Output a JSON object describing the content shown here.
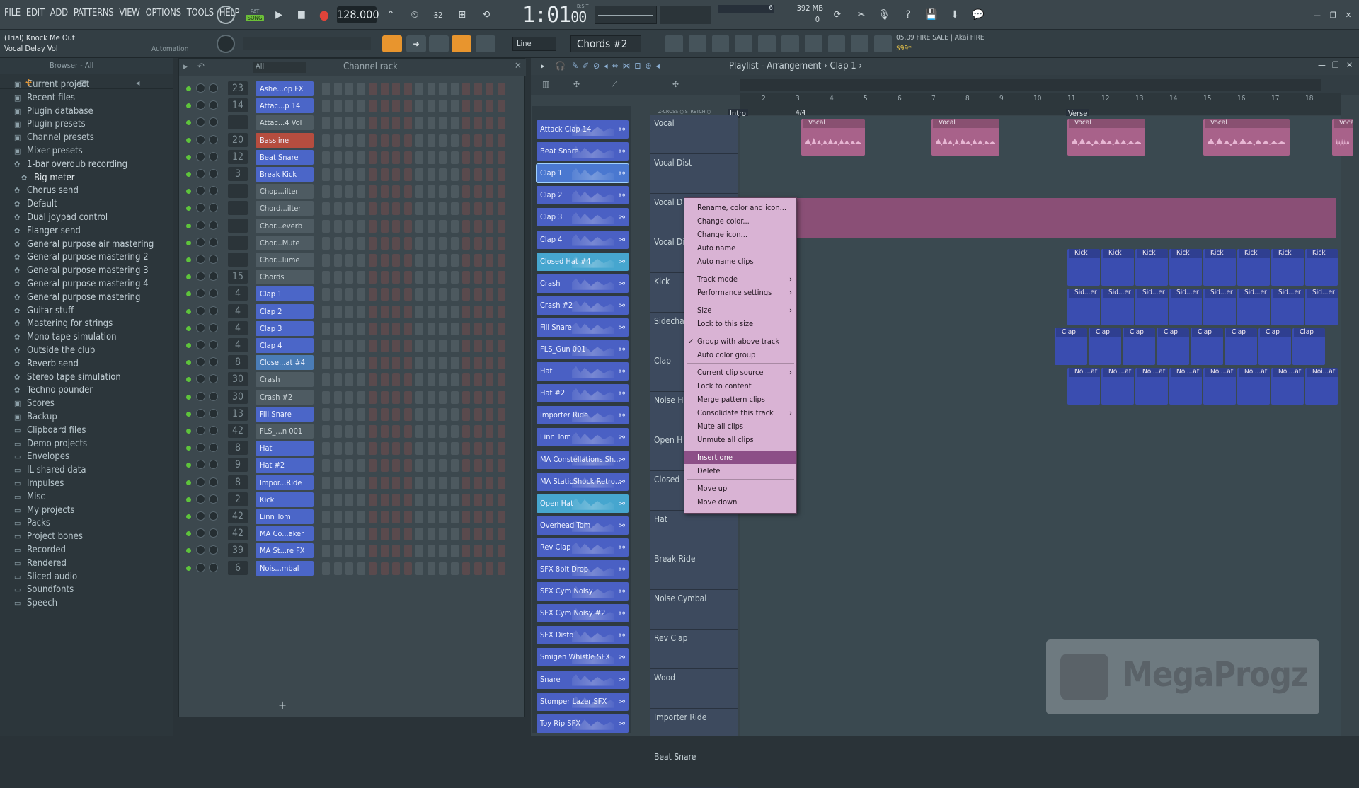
{
  "menu": [
    "FILE",
    "EDIT",
    "ADD",
    "PATTERNS",
    "VIEW",
    "OPTIONS",
    "TOOLS",
    "HELP"
  ],
  "transport": {
    "pat_label": "PAT",
    "song_label": "SONG",
    "bpm": "128.000",
    "time": "1:01",
    "time_sub": "00",
    "bst": "B:S:T"
  },
  "memory": {
    "value": "392 MB",
    "zero": "0",
    "cpu": "6"
  },
  "hint": {
    "line1": "(Trial) Knock Me Out",
    "line2": "Vocal Delay Vol",
    "line3": "Automation"
  },
  "snap": {
    "value": "Line"
  },
  "pattern": {
    "value": "Chords #2"
  },
  "news": {
    "line1": "05.09  FIRE SALE | Akai FIRE",
    "line2": "$99*"
  },
  "browser": {
    "title": "Browser - All",
    "items": [
      {
        "label": "Current project",
        "kind": "sec"
      },
      {
        "label": "Recent files",
        "kind": "sec"
      },
      {
        "label": "Plugin database",
        "kind": "sec"
      },
      {
        "label": "Plugin presets",
        "kind": "sec"
      },
      {
        "label": "Channel presets",
        "kind": "sec"
      },
      {
        "label": "Mixer presets",
        "kind": "sec"
      },
      {
        "label": "1-bar overdub recording",
        "kind": "item"
      },
      {
        "label": "Big meter",
        "kind": "hl"
      },
      {
        "label": "Chorus send",
        "kind": "item"
      },
      {
        "label": "Default",
        "kind": "item"
      },
      {
        "label": "Dual joypad control",
        "kind": "item"
      },
      {
        "label": "Flanger send",
        "kind": "item"
      },
      {
        "label": "General purpose air mastering",
        "kind": "item"
      },
      {
        "label": "General purpose mastering 2",
        "kind": "item"
      },
      {
        "label": "General purpose mastering 3",
        "kind": "item"
      },
      {
        "label": "General purpose mastering 4",
        "kind": "item"
      },
      {
        "label": "General purpose mastering",
        "kind": "item"
      },
      {
        "label": "Guitar stuff",
        "kind": "item"
      },
      {
        "label": "Mastering for strings",
        "kind": "item"
      },
      {
        "label": "Mono tape simulation",
        "kind": "item"
      },
      {
        "label": "Outside the club",
        "kind": "item"
      },
      {
        "label": "Reverb send",
        "kind": "item"
      },
      {
        "label": "Stereo tape simulation",
        "kind": "item"
      },
      {
        "label": "Techno pounder",
        "kind": "item"
      },
      {
        "label": "Scores",
        "kind": "sec"
      },
      {
        "label": "Backup",
        "kind": "sec"
      },
      {
        "label": "Clipboard files",
        "kind": "f"
      },
      {
        "label": "Demo projects",
        "kind": "f"
      },
      {
        "label": "Envelopes",
        "kind": "f"
      },
      {
        "label": "IL shared data",
        "kind": "f"
      },
      {
        "label": "Impulses",
        "kind": "f"
      },
      {
        "label": "Misc",
        "kind": "f"
      },
      {
        "label": "My projects",
        "kind": "f"
      },
      {
        "label": "Packs",
        "kind": "f"
      },
      {
        "label": "Project bones",
        "kind": "f"
      },
      {
        "label": "Recorded",
        "kind": "f"
      },
      {
        "label": "Rendered",
        "kind": "f"
      },
      {
        "label": "Sliced audio",
        "kind": "f"
      },
      {
        "label": "Soundfonts",
        "kind": "f"
      },
      {
        "label": "Speech",
        "kind": "f"
      }
    ]
  },
  "channel_rack": {
    "title": "Channel rack",
    "filter": "All",
    "channels": [
      {
        "num": "23",
        "name": "Ashe...op FX",
        "style": "blue"
      },
      {
        "num": "14",
        "name": "Attac...p 14",
        "style": "blue"
      },
      {
        "num": "",
        "name": "Attac...4 Vol",
        "style": "gray"
      },
      {
        "num": "20",
        "name": "Bassline",
        "style": "red"
      },
      {
        "num": "12",
        "name": "Beat Snare",
        "style": "blue"
      },
      {
        "num": "3",
        "name": "Break Kick",
        "style": "blue"
      },
      {
        "num": "",
        "name": "Chop...ilter",
        "style": "gray"
      },
      {
        "num": "",
        "name": "Chord...ilter",
        "style": "gray"
      },
      {
        "num": "",
        "name": "Chor...everb",
        "style": "gray"
      },
      {
        "num": "",
        "name": "Chor...Mute",
        "style": "gray"
      },
      {
        "num": "",
        "name": "Chor...lume",
        "style": "gray"
      },
      {
        "num": "15",
        "name": "Chords",
        "style": "gray"
      },
      {
        "num": "4",
        "name": "Clap 1",
        "style": "blue"
      },
      {
        "num": "4",
        "name": "Clap 2",
        "style": "blue"
      },
      {
        "num": "4",
        "name": "Clap 3",
        "style": "blue"
      },
      {
        "num": "4",
        "name": "Clap 4",
        "style": "blue"
      },
      {
        "num": "8",
        "name": "Close...at #4",
        "style": "sel"
      },
      {
        "num": "30",
        "name": "Crash",
        "style": "gray"
      },
      {
        "num": "30",
        "name": "Crash #2",
        "style": "gray"
      },
      {
        "num": "13",
        "name": "Fill Snare",
        "style": "blue"
      },
      {
        "num": "42",
        "name": "FLS_...n 001",
        "style": "gray"
      },
      {
        "num": "8",
        "name": "Hat",
        "style": "blue"
      },
      {
        "num": "9",
        "name": "Hat #2",
        "style": "blue"
      },
      {
        "num": "8",
        "name": "Impor...Ride",
        "style": "blue"
      },
      {
        "num": "2",
        "name": "Kick",
        "style": "blue"
      },
      {
        "num": "42",
        "name": "Linn Tom",
        "style": "blue"
      },
      {
        "num": "42",
        "name": "MA Co...aker",
        "style": "blue"
      },
      {
        "num": "39",
        "name": "MA St...re FX",
        "style": "blue"
      },
      {
        "num": "6",
        "name": "Nois...mbal",
        "style": "blue"
      }
    ],
    "add_label": "+"
  },
  "picker": {
    "items": [
      {
        "label": "Attack Clap 14",
        "style": "blue"
      },
      {
        "label": "Beat Snare",
        "style": "blue"
      },
      {
        "label": "Clap 1",
        "style": "sel"
      },
      {
        "label": "Clap 2",
        "style": "blue"
      },
      {
        "label": "Clap 3",
        "style": "blue"
      },
      {
        "label": "Clap 4",
        "style": "blue"
      },
      {
        "label": "Closed Hat #4",
        "style": "teal"
      },
      {
        "label": "Crash",
        "style": "blue"
      },
      {
        "label": "Crash #2",
        "style": "blue"
      },
      {
        "label": "Fill Snare",
        "style": "blue"
      },
      {
        "label": "FLS_Gun 001",
        "style": "blue"
      },
      {
        "label": "Hat",
        "style": "blue"
      },
      {
        "label": "Hat #2",
        "style": "blue"
      },
      {
        "label": "Importer Ride",
        "style": "blue"
      },
      {
        "label": "Linn Tom",
        "style": "blue"
      },
      {
        "label": "MA Constellations Sh...",
        "style": "blue"
      },
      {
        "label": "MA StaticShock Retro...",
        "style": "blue"
      },
      {
        "label": "Open Hat",
        "style": "teal"
      },
      {
        "label": "Overhead Tom",
        "style": "blue"
      },
      {
        "label": "Rev Clap",
        "style": "blue"
      },
      {
        "label": "SFX 8bit Drop",
        "style": "blue"
      },
      {
        "label": "SFX Cym Noisy",
        "style": "blue"
      },
      {
        "label": "SFX Cym Noisy #2",
        "style": "blue"
      },
      {
        "label": "SFX Disto",
        "style": "blue"
      },
      {
        "label": "Smigen Whistle SFX",
        "style": "blue"
      },
      {
        "label": "Snare",
        "style": "blue"
      },
      {
        "label": "Stomper Lazer SFX",
        "style": "blue"
      },
      {
        "label": "Toy Rip SFX",
        "style": "blue"
      }
    ]
  },
  "playlist": {
    "title": "Playlist - Arrangement",
    "breadcrumb": "Clap 1",
    "markers": {
      "intro": "Intro",
      "time_sig": "4/4",
      "verse": "Verse"
    },
    "ruler": [
      "2",
      "3",
      "4",
      "5",
      "6",
      "7",
      "8",
      "9",
      "10",
      "11",
      "12",
      "13",
      "14",
      "15",
      "16",
      "17",
      "18"
    ],
    "crossfade": "Z-CROSS",
    "stretch": "STRETCH",
    "tracks": [
      "Vocal",
      "Vocal Dist",
      "Vocal D",
      "Vocal Di",
      "Kick",
      "Sidecha",
      "Clap",
      "Noise H",
      "Open H",
      "Closed",
      "Hat",
      "Break Ride",
      "Noise Cymbal",
      "Rev Clap",
      "Wood",
      "Importer Ride",
      "Beat Snare"
    ],
    "clip_labels": {
      "vocal": "Vocal",
      "kick": "Kick",
      "side": "Sid...er",
      "clap": "Clap",
      "noise": "Noi...at"
    }
  },
  "context_menu": {
    "items": [
      {
        "label": "Rename, color and icon...",
        "type": "item"
      },
      {
        "label": "Change color...",
        "type": "item"
      },
      {
        "label": "Change icon...",
        "type": "item"
      },
      {
        "label": "Auto name",
        "type": "item"
      },
      {
        "label": "Auto name clips",
        "type": "item"
      },
      {
        "type": "sep"
      },
      {
        "label": "Track mode",
        "type": "sub"
      },
      {
        "label": "Performance settings",
        "type": "sub"
      },
      {
        "type": "sep"
      },
      {
        "label": "Size",
        "type": "sub"
      },
      {
        "label": "Lock to this size",
        "type": "item"
      },
      {
        "type": "sep"
      },
      {
        "label": "Group with above track",
        "type": "check"
      },
      {
        "label": "Auto color group",
        "type": "item"
      },
      {
        "type": "sep"
      },
      {
        "label": "Current clip source",
        "type": "sub"
      },
      {
        "label": "Lock to content",
        "type": "item"
      },
      {
        "label": "Merge pattern clips",
        "type": "item"
      },
      {
        "label": "Consolidate this track",
        "type": "sub"
      },
      {
        "label": "Mute all clips",
        "type": "item"
      },
      {
        "label": "Unmute all clips",
        "type": "item"
      },
      {
        "type": "sep"
      },
      {
        "label": "Insert one",
        "type": "active"
      },
      {
        "label": "Delete",
        "type": "item"
      },
      {
        "type": "sep"
      },
      {
        "label": "Move up",
        "type": "item"
      },
      {
        "label": "Move down",
        "type": "item"
      }
    ]
  },
  "watermark": {
    "text": "MegaProgz"
  },
  "colors": {
    "accent": "#e8952e",
    "channel_blue": "#4b66c8",
    "vocal_clip": "#a8628a",
    "menu_bg": "#d9b3d4",
    "menu_active": "#8c4f87"
  }
}
